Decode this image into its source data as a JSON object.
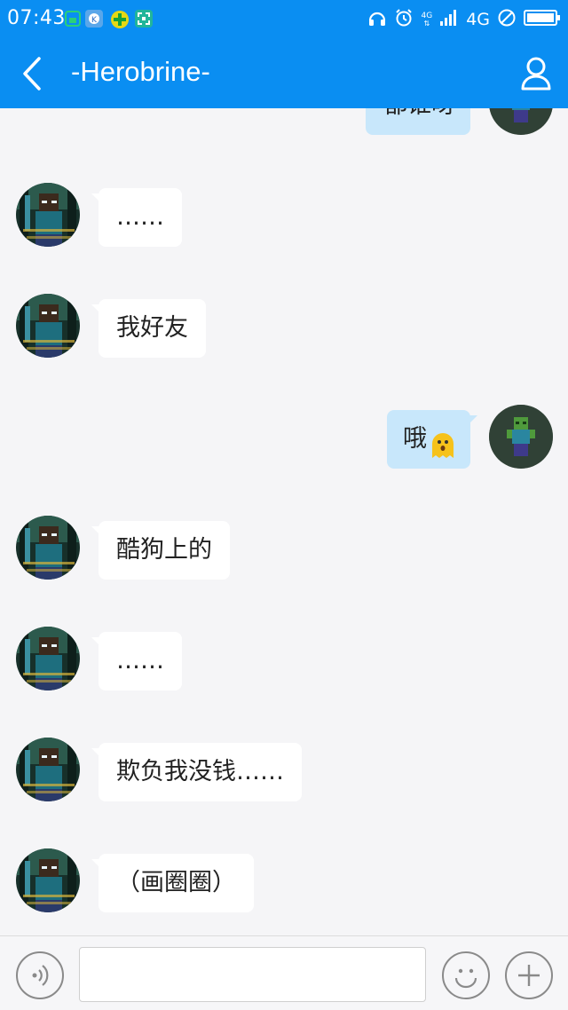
{
  "status_bar": {
    "time": "07:43",
    "network_small": "4G",
    "network": "4G",
    "icons": [
      "mobile-data-app-icon",
      "k-app-icon",
      "plus-app-icon",
      "scan-app-icon",
      "headphones-icon",
      "alarm-icon",
      "signal-icon",
      "no-disturb-icon",
      "battery-icon"
    ],
    "colors": {
      "bar": "#0a8ef2"
    }
  },
  "header": {
    "title": "-Herobrine-",
    "icons": [
      "back-arrow-icon",
      "profile-icon"
    ]
  },
  "messages": [
    {
      "side": "out",
      "text": "都谁呀",
      "partial": true
    },
    {
      "side": "in",
      "text": "……"
    },
    {
      "side": "in",
      "text": "我好友"
    },
    {
      "side": "out",
      "text": "哦",
      "emoji": "surprised-face-emoji"
    },
    {
      "side": "in",
      "text": "酷狗上的"
    },
    {
      "side": "in",
      "text": "……"
    },
    {
      "side": "in",
      "text": "欺负我没钱……"
    },
    {
      "side": "in",
      "text": "（画圈圈）"
    }
  ],
  "input_bar": {
    "placeholder": "",
    "icons": [
      "voice-icon",
      "emoji-icon",
      "plus-icon"
    ]
  },
  "colors": {
    "accent": "#0a8ef2",
    "outgoing_bubble": "#c8e7fb",
    "incoming_bubble": "#ffffff",
    "chat_background": "#f5f5f7"
  }
}
